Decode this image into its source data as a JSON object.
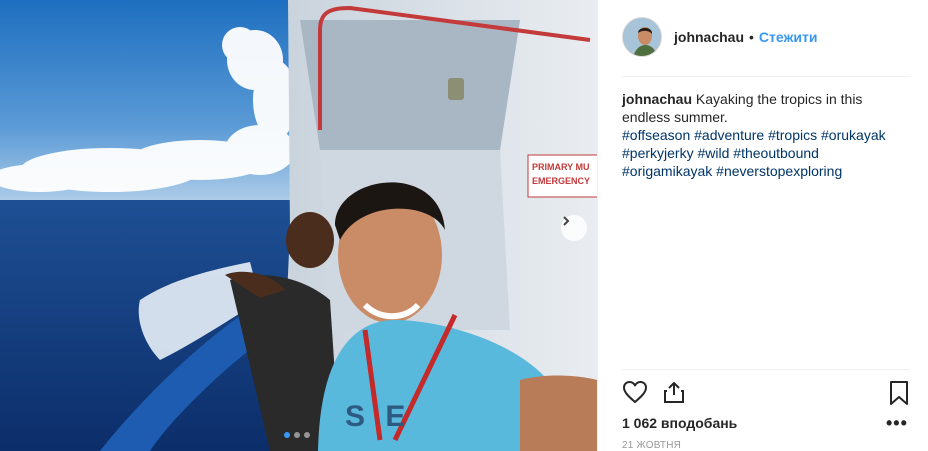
{
  "post": {
    "username": "johnachau",
    "separator": "•",
    "follow_label": "Стежити",
    "caption": {
      "username": "johnachau",
      "text": "Kayaking the tropics in this endless summer.",
      "hashtags": [
        "#offseason",
        "#adventure",
        "#tropics",
        "#orukayak",
        "#perkyjerky",
        "#wild",
        "#theoutbound",
        "#origamikayak",
        "#neverstopexploring"
      ]
    },
    "likes": "1 062 вподобань",
    "date": "21 жовтня",
    "more_label": "•••",
    "photo": {
      "sign_line1": "PRIMARY MU",
      "sign_line2": "EMERGENCY",
      "shirt_text": "S  E",
      "carousel_dots": 3,
      "active_dot": 0
    }
  },
  "icons": {
    "like": "heart-icon",
    "share": "share-icon",
    "save": "bookmark-icon",
    "next": "chevron-right-icon"
  },
  "colors": {
    "link_blue": "#3897f0",
    "hashtag": "#003569",
    "muted": "#999999"
  }
}
